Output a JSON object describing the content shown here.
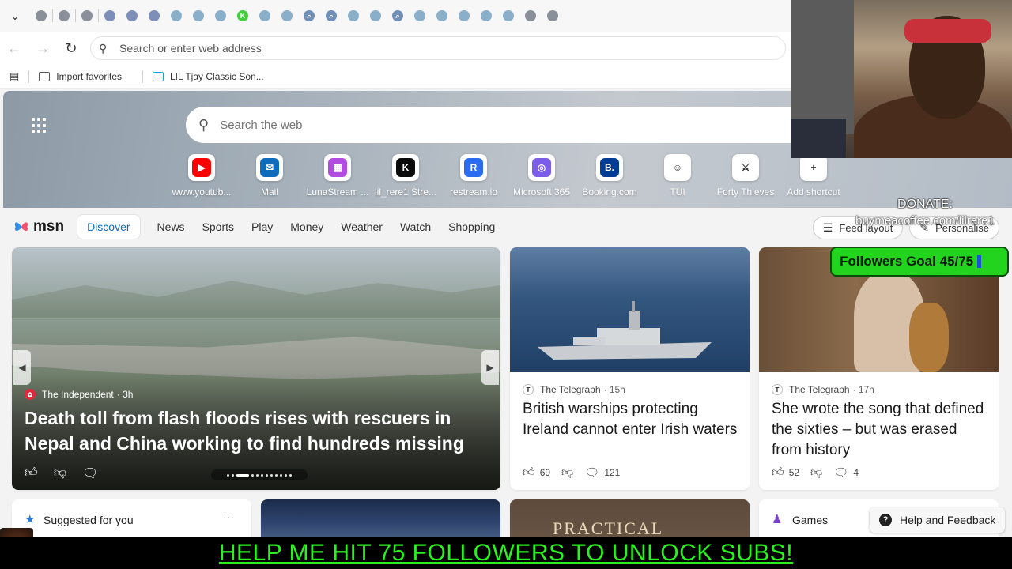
{
  "tabs": [
    {
      "label": "",
      "icon": "globe-icon"
    },
    {
      "label": "",
      "icon": "globe-icon"
    },
    {
      "label": "",
      "icon": "globe-icon"
    },
    {
      "label": "",
      "icon": "restream-icon"
    },
    {
      "label": "",
      "icon": "restream-icon"
    },
    {
      "label": "",
      "icon": "restream-icon"
    },
    {
      "label": "",
      "icon": "app-icon"
    },
    {
      "label": "",
      "icon": "app-icon"
    },
    {
      "label": "",
      "icon": "app-icon"
    },
    {
      "label": "",
      "icon": "kick-icon"
    },
    {
      "label": "",
      "icon": "app-icon"
    },
    {
      "label": "",
      "icon": "app-icon"
    },
    {
      "label": "",
      "icon": "search-icon"
    },
    {
      "label": "",
      "icon": "search-icon"
    },
    {
      "label": "",
      "icon": "app-icon"
    },
    {
      "label": "",
      "icon": "app-icon"
    },
    {
      "label": "",
      "icon": "search-icon"
    },
    {
      "label": "",
      "icon": "app-icon"
    },
    {
      "label": "",
      "icon": "app-icon"
    },
    {
      "label": "",
      "icon": "app-icon"
    },
    {
      "label": "",
      "icon": "app-icon"
    },
    {
      "label": "",
      "icon": "app-icon"
    },
    {
      "label": "",
      "icon": "globe-icon"
    },
    {
      "label": "",
      "icon": "globe-icon"
    }
  ],
  "address_bar": {
    "placeholder": "Search or enter web address"
  },
  "favorites": {
    "import_label": "Import favorites",
    "item_label": "LIL Tjay Classic Son..."
  },
  "hero": {
    "search_placeholder": "Search the web",
    "shortcuts": [
      {
        "label": "www.youtub...",
        "color": "#ff0000",
        "glyph": "▶"
      },
      {
        "label": "Mail",
        "color": "#0f6cbd",
        "glyph": "✉"
      },
      {
        "label": "LunaStream ...",
        "color": "#b04de0",
        "glyph": "▦"
      },
      {
        "label": "lil_rere1 Stre...",
        "color": "#0a0a0a",
        "glyph": "K"
      },
      {
        "label": "restream.io",
        "color": "#2c6cf0",
        "glyph": "R"
      },
      {
        "label": "Microsoft 365",
        "color": "#7b5ce8",
        "glyph": "◎"
      },
      {
        "label": "Booking.com",
        "color": "#003b95",
        "glyph": "B."
      },
      {
        "label": "TUI",
        "color": "#ffffff",
        "glyph": "☺"
      },
      {
        "label": "Forty Thieves",
        "color": "#ffffff",
        "glyph": "⚔"
      },
      {
        "label": "Add shortcut",
        "color": "#ffffff",
        "glyph": "+"
      }
    ]
  },
  "msn": {
    "logo_text": "msn",
    "tabs": [
      "Discover",
      "News",
      "Sports",
      "Play",
      "Money",
      "Weather",
      "Watch",
      "Shopping"
    ],
    "feed_layout": "Feed layout",
    "personalise": "Personalise"
  },
  "main_story": {
    "source": "The Independent",
    "age": "· 3h",
    "title": "Death toll from flash floods rises with rescuers in Nepal and China working to find hundreds missing",
    "carousel_count": 12,
    "carousel_index": 2
  },
  "stories": [
    {
      "source": "The Telegraph",
      "age": "· 15h",
      "title": "British warships protecting Ireland cannot enter Irish waters",
      "likes": "69",
      "comments": "121"
    },
    {
      "source": "The Telegraph",
      "age": "· 17h",
      "title": "She wrote the song that defined the sixties – but was erased from history",
      "likes": "52",
      "comments": "4"
    }
  ],
  "row2": {
    "suggested": "Suggested for you",
    "more": "···",
    "practical_text": "PRACTICAL",
    "games": "Games",
    "help": "Help and Feedback"
  },
  "overlay": {
    "donate_label": "DONATE:",
    "donate_url": "buymeacoffee.com/lilrere1",
    "goal_text": "Followers Goal 45/75",
    "goal_current": 45,
    "goal_target": 75,
    "banner_text": "HELP ME HIT 75 FOLLOWERS TO UNLOCK SUBS!"
  }
}
